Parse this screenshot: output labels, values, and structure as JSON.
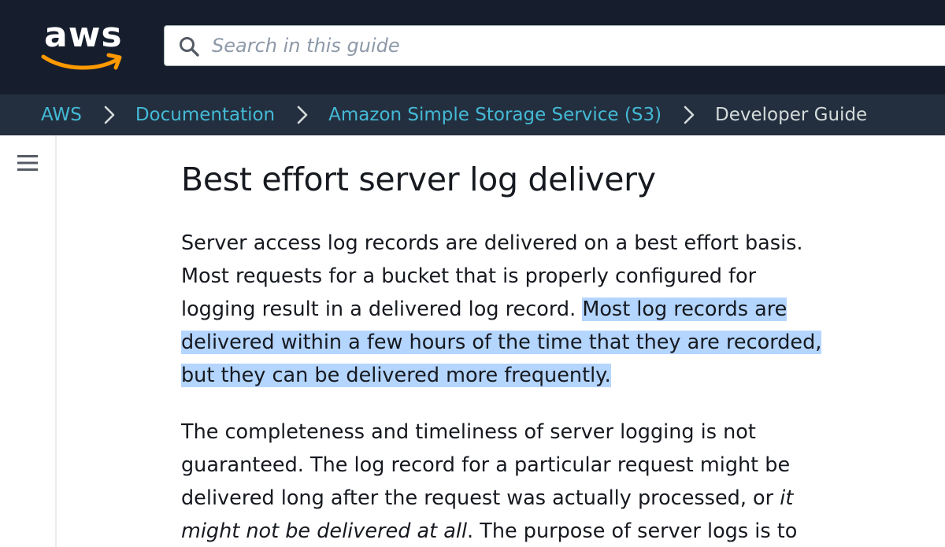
{
  "header": {
    "logo_text": "aws",
    "search": {
      "placeholder": "Search in this guide"
    }
  },
  "breadcrumb": {
    "items": [
      "AWS",
      "Documentation",
      "Amazon Simple Storage Service (S3)"
    ],
    "current": "Developer Guide"
  },
  "icons": {
    "logo": "aws-logo",
    "search": "search-icon",
    "separator": "chevron-right-icon",
    "menu": "hamburger-menu-icon"
  },
  "colors": {
    "topbar": "#161e2d",
    "breadcrumb_bar": "#232f3e",
    "link": "#44b9d6",
    "smile": "#ff9900",
    "selection": "#b4d5fe"
  },
  "main": {
    "title": "Best effort server log delivery",
    "paragraph1": {
      "lead": "Server access log records are delivered on a best effort basis. Most requests for a bucket that is properly configured for logging result in a delivered log record. ",
      "highlighted": "Most log records are delivered within a few hours of the time that they are recorded, but they can be delivered more frequently."
    },
    "paragraph2": {
      "lead": "The completeness and timeliness of server logging is not guaranteed. The log record for a particular request might be delivered long after the request was actually processed, or ",
      "emphasis": "it might not be delivered at all",
      "tail": ". The purpose of server logs is to"
    }
  }
}
